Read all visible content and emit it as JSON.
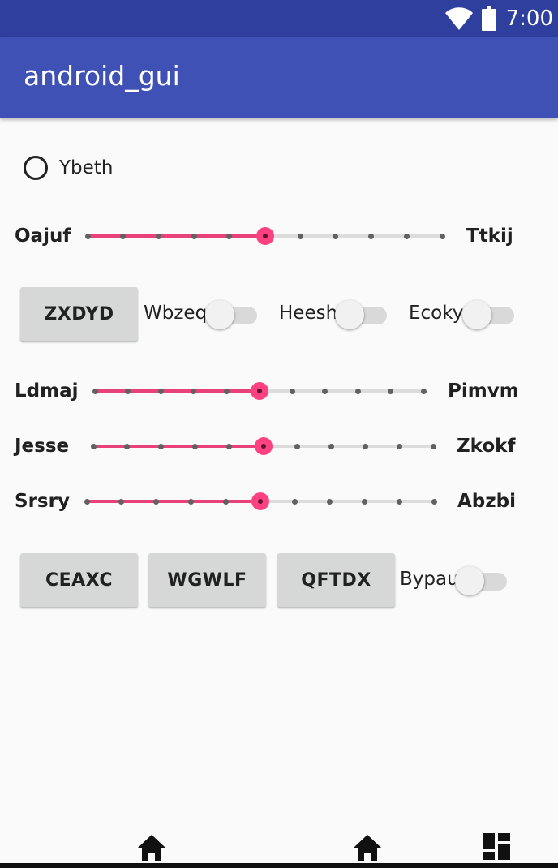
{
  "status_bar": {
    "time": "7:00",
    "wifi_icon": "wifi-icon",
    "battery_icon": "battery-icon"
  },
  "app_bar": {
    "title": "android_gui",
    "color": "#3f51b5"
  },
  "radio": {
    "label": "Ybeth",
    "checked": false
  },
  "seekbars": [
    {
      "left_label": "Oajuf",
      "right_label": "Ttkij",
      "value": 5,
      "max": 10
    },
    {
      "left_label": "Ldmaj",
      "right_label": "Pimvm",
      "value": 5,
      "max": 10
    },
    {
      "left_label": "Jesse",
      "right_label": "Zkokf",
      "value": 5,
      "max": 10
    },
    {
      "left_label": "Srsry",
      "right_label": "Abzbi",
      "value": 5,
      "max": 10
    }
  ],
  "row1": {
    "button": "ZXDYD",
    "switches": [
      {
        "label": "Wbzeq",
        "on": false
      },
      {
        "label": "Heesh",
        "on": false
      },
      {
        "label": "Ecoky",
        "on": false
      }
    ]
  },
  "row2": {
    "buttons": [
      "CEAXC",
      "WGWLF",
      "QFTDX"
    ],
    "switch": {
      "label": "Bypau",
      "on": false
    }
  },
  "nav": {
    "icons": [
      "home-icon",
      "home-icon",
      "dashboard-icon"
    ]
  },
  "colors": {
    "accent": "#ff4081",
    "primary_dark": "#303f9f"
  }
}
